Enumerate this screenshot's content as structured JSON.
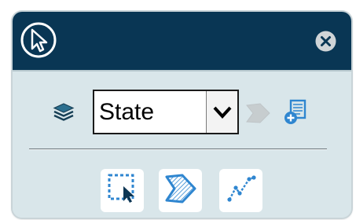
{
  "toolbar": {
    "layer": {
      "selected_value": "State"
    }
  },
  "icons": {
    "cursor": "cursor-arrow-icon",
    "close": "close-icon",
    "layers": "layers-icon",
    "dropdown": "chevron-down-icon",
    "polygon_disabled": "polygon-select-icon",
    "add_layer": "add-layer-icon"
  },
  "tools": [
    {
      "name": "rectangle-select-tool",
      "icon": "rectangle-select-icon"
    },
    {
      "name": "polygon-select-tool",
      "icon": "polygon-select-icon"
    },
    {
      "name": "polyline-select-tool",
      "icon": "polyline-select-icon"
    }
  ],
  "colors": {
    "header": "#093654",
    "panel": "#d9e6ea",
    "accent": "#2f86d0"
  }
}
